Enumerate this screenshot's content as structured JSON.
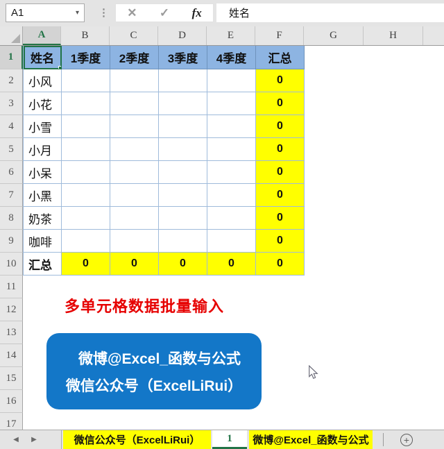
{
  "name_box": {
    "value": "A1"
  },
  "formula_bar": {
    "value": "姓名"
  },
  "icons": {
    "dropdown": "▾",
    "dots": "⋮",
    "cancel": "✕",
    "enter": "✓",
    "fx": "fx",
    "prev": "◀",
    "next": "▶",
    "add": "+"
  },
  "column_headers": [
    "A",
    "B",
    "C",
    "D",
    "E",
    "F",
    "G",
    "H"
  ],
  "row_numbers": [
    "1",
    "2",
    "3",
    "4",
    "5",
    "6",
    "7",
    "8",
    "9",
    "10",
    "11",
    "12",
    "13",
    "14",
    "15",
    "16",
    "17"
  ],
  "table": {
    "header": [
      "姓名",
      "1季度",
      "2季度",
      "3季度",
      "4季度",
      "汇总"
    ],
    "rows": [
      {
        "name": "小风",
        "total": "0"
      },
      {
        "name": "小花",
        "total": "0"
      },
      {
        "name": "小雪",
        "total": "0"
      },
      {
        "name": "小月",
        "total": "0"
      },
      {
        "name": "小呆",
        "total": "0"
      },
      {
        "name": "小黑",
        "total": "0"
      },
      {
        "name": "奶茶",
        "total": "0"
      },
      {
        "name": "咖啡",
        "total": "0"
      }
    ],
    "total_row": {
      "label": "汇总",
      "values": [
        "0",
        "0",
        "0",
        "0",
        "0"
      ]
    }
  },
  "annotations": {
    "note": "多单元格数据批量输入",
    "banner_line1": "微博@Excel_函数与公式",
    "banner_line2": "微信公众号（ExcelLiRui）"
  },
  "sheet_tabs": [
    {
      "label": "微信公众号（ExcelLiRui）"
    },
    {
      "label": "1"
    },
    {
      "label": "微博@Excel_函数与公式"
    }
  ],
  "colors": {
    "table_header_fill": "#8DB4E2",
    "highlight_fill": "#FFFF00",
    "banner_fill": "#1377C8",
    "note_color": "#E60000",
    "excel_green": "#217346",
    "sheet_tab_fill": "#FFFF00"
  }
}
